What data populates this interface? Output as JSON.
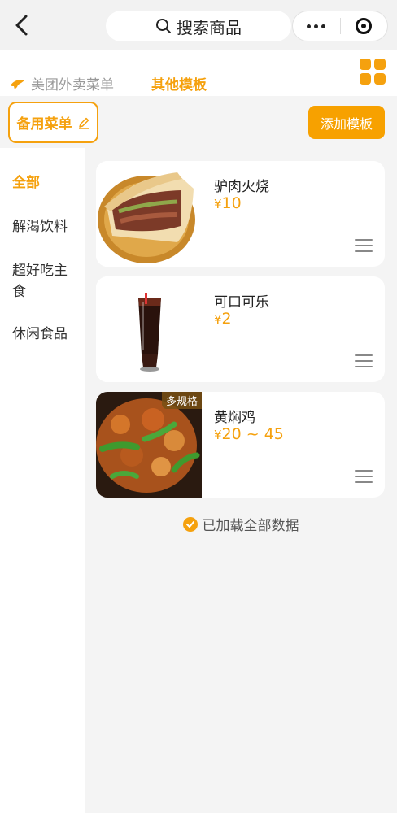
{
  "nav": {
    "search_label": "搜索商品"
  },
  "tabs": {
    "meituan_label": "美团外卖菜单",
    "other_label": "其他模板"
  },
  "template": {
    "menu_name": "备用菜单",
    "add_label": "添加模板"
  },
  "categories": [
    {
      "label": "全部",
      "active": true
    },
    {
      "label": "解渴饮料",
      "active": false
    },
    {
      "label": "超好吃主食",
      "active": false
    },
    {
      "label": "休闲食品",
      "active": false
    }
  ],
  "products": [
    {
      "name": "驴肉火烧",
      "currency": "¥",
      "price": "10",
      "badge": "",
      "image": "donkey-meat-burger"
    },
    {
      "name": "可口可乐",
      "currency": "¥",
      "price": "2",
      "badge": "",
      "image": "cola-glass"
    },
    {
      "name": "黄焖鸡",
      "currency": "¥",
      "price": "20 ~ 45",
      "badge": "多规格",
      "image": "braised-chicken"
    }
  ],
  "footer": {
    "loaded_text": "已加载全部数据"
  },
  "colors": {
    "accent": "#f5a10e",
    "button": "#f7a100",
    "background": "#f4f4f4"
  }
}
